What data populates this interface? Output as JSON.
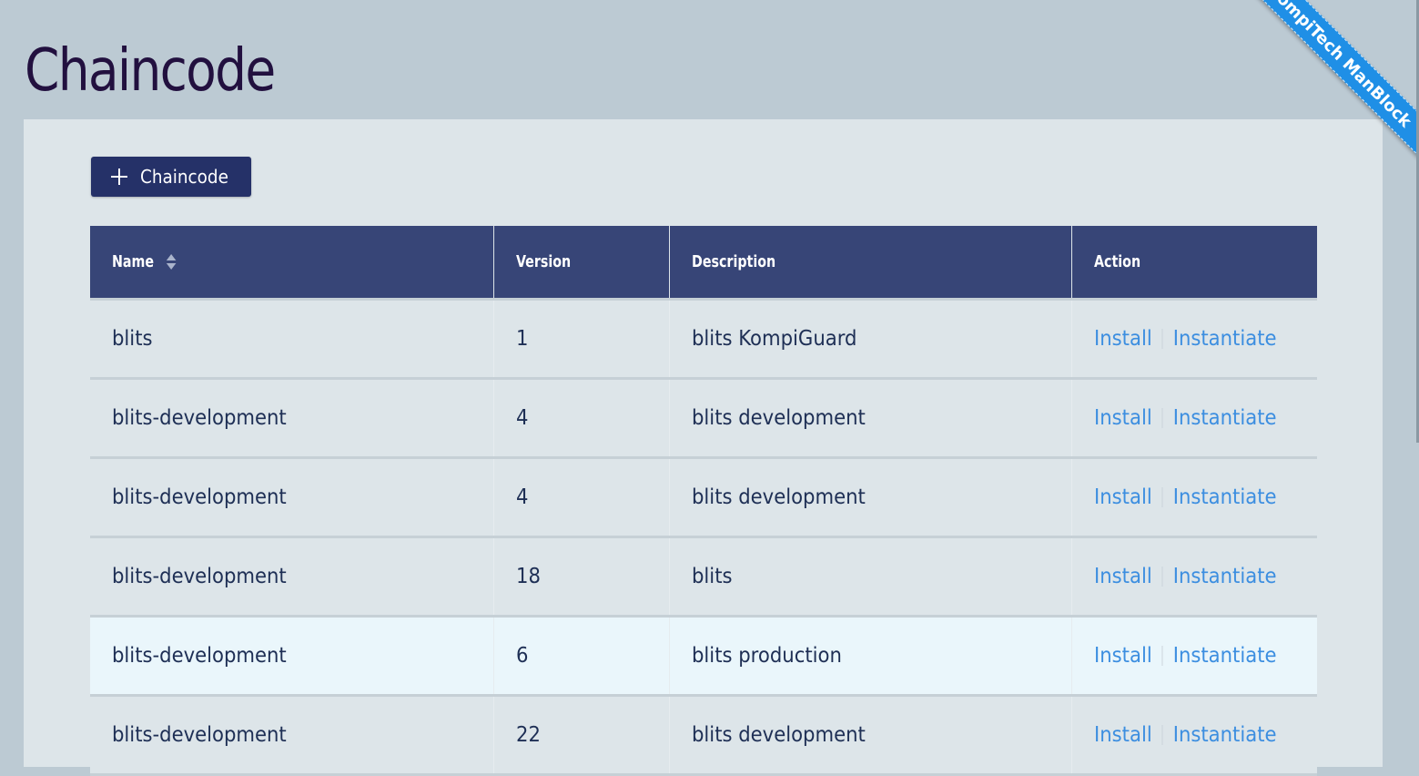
{
  "page": {
    "title": "Chaincode"
  },
  "toolbar": {
    "add_button_label": "Chaincode",
    "add_button_icon": "plus-icon"
  },
  "table": {
    "columns": [
      {
        "label": "Name",
        "sortable": true
      },
      {
        "label": "Version",
        "sortable": false
      },
      {
        "label": "Description",
        "sortable": false
      },
      {
        "label": "Action",
        "sortable": false
      }
    ],
    "rows": [
      {
        "name": "blits",
        "version": "1",
        "description": "blits KompiGuard",
        "actions": [
          "Install",
          "Instantiate"
        ]
      },
      {
        "name": "blits-development",
        "version": "4",
        "description": "blits development",
        "actions": [
          "Install",
          "Instantiate"
        ]
      },
      {
        "name": "blits-development",
        "version": "4",
        "description": "blits development",
        "actions": [
          "Install",
          "Instantiate"
        ]
      },
      {
        "name": "blits-development",
        "version": "18",
        "description": "blits",
        "actions": [
          "Install",
          "Instantiate"
        ]
      },
      {
        "name": "blits-development",
        "version": "6",
        "description": "blits production",
        "actions": [
          "Install",
          "Instantiate"
        ],
        "hovered": true
      },
      {
        "name": "blits-development",
        "version": "22",
        "description": "blits development",
        "actions": [
          "Install",
          "Instantiate"
        ]
      }
    ]
  },
  "ribbon": {
    "text": "KompiTech ManBlock"
  },
  "colors": {
    "background": "#bccad3",
    "panel": "#dde5e9",
    "header": "#374577",
    "button": "#253168",
    "link": "#3c8ee0",
    "title": "#22103f",
    "ribbon": "#1f8fe6",
    "row_highlight": "#eaf6fb"
  }
}
